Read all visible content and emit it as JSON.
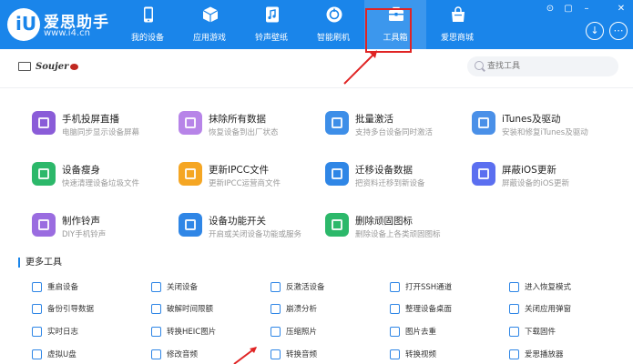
{
  "app": {
    "brand_name": "爱思助手",
    "brand_url": "www.i4.cn",
    "logo_glyph": "iU"
  },
  "nav": [
    {
      "label": "我的设备",
      "icon": "phone-icon"
    },
    {
      "label": "应用游戏",
      "icon": "cube-icon"
    },
    {
      "label": "铃声壁纸",
      "icon": "music-icon"
    },
    {
      "label": "智能刷机",
      "icon": "flash-icon"
    },
    {
      "label": "工具箱",
      "icon": "toolbox-icon"
    },
    {
      "label": "爱思商城",
      "icon": "shopping-bag-icon"
    }
  ],
  "window_controls": [
    "⊙",
    "▢",
    "–",
    "✕"
  ],
  "header_buttons": {
    "download": "↓",
    "more": "⋯"
  },
  "device": {
    "name": "Soujer"
  },
  "search": {
    "placeholder": "查找工具"
  },
  "tools": [
    {
      "title": "手机投屏直播",
      "desc": "电脑同步显示设备屏幕",
      "icon": "screen-mirror-icon",
      "color": "#8a5cd8"
    },
    {
      "title": "抹除所有数据",
      "desc": "恢复设备到出厂状态",
      "icon": "eraser-icon",
      "color": "#b784e8"
    },
    {
      "title": "批量激活",
      "desc": "支持多台设备同时激活",
      "icon": "batch-activate-icon",
      "color": "#3d8ee8"
    },
    {
      "title": "iTunes及驱动",
      "desc": "安装和修复iTunes及驱动",
      "icon": "itunes-icon",
      "color": "#4a90e8"
    },
    {
      "title": "设备瘦身",
      "desc": "快速清理设备垃圾文件",
      "icon": "broom-icon",
      "color": "#2cb86a"
    },
    {
      "title": "更新IPCC文件",
      "desc": "更新IPCC运营商文件",
      "icon": "ipcc-icon",
      "color": "#f5a623"
    },
    {
      "title": "迁移设备数据",
      "desc": "把资料迁移到新设备",
      "icon": "migrate-icon",
      "color": "#2f86e6"
    },
    {
      "title": "屏蔽iOS更新",
      "desc": "屏蔽设备的iOS更新",
      "icon": "block-update-icon",
      "color": "#5b6ff0"
    },
    {
      "title": "制作铃声",
      "desc": "DIY手机铃声",
      "icon": "ringtone-icon",
      "color": "#9a6ce0"
    },
    {
      "title": "设备功能开关",
      "desc": "开启或关闭设备功能或服务",
      "icon": "toggle-icon",
      "color": "#2f86e6"
    },
    {
      "title": "删除顽固图标",
      "desc": "删除设备上各类顽固图标",
      "icon": "trash-icon",
      "color": "#2cb86a"
    }
  ],
  "more_tools_title": "更多工具",
  "small_tools": [
    {
      "label": "重启设备",
      "icon": "restart-icon",
      "color": "#2f86e6"
    },
    {
      "label": "关闭设备",
      "icon": "power-icon",
      "color": "#2f86e6"
    },
    {
      "label": "反激活设备",
      "icon": "deactivate-icon",
      "color": "#2f86e6"
    },
    {
      "label": "打开SSH通道",
      "icon": "ssh-icon",
      "color": "#2f86e6"
    },
    {
      "label": "进入恢复模式",
      "icon": "recovery-icon",
      "color": "#2f86e6"
    },
    {
      "label": "备份引导数据",
      "icon": "backup-icon",
      "color": "#2f86e6"
    },
    {
      "label": "破解时间限额",
      "icon": "time-limit-icon",
      "color": "#2f86e6"
    },
    {
      "label": "崩溃分析",
      "icon": "crash-analysis-icon",
      "color": "#2f86e6"
    },
    {
      "label": "整理设备桌面",
      "icon": "desktop-organize-icon",
      "color": "#2f86e6"
    },
    {
      "label": "关闭应用弹窗",
      "icon": "close-popup-icon",
      "color": "#2f86e6"
    },
    {
      "label": "实时日志",
      "icon": "log-icon",
      "color": "#2f86e6"
    },
    {
      "label": "转换HEIC图片",
      "icon": "heic-icon",
      "color": "#2f86e6"
    },
    {
      "label": "压缩照片",
      "icon": "compress-photo-icon",
      "color": "#2f86e6"
    },
    {
      "label": "图片去重",
      "icon": "dedupe-icon",
      "color": "#2f86e6"
    },
    {
      "label": "下载固件",
      "icon": "firmware-icon",
      "color": "#2f86e6"
    },
    {
      "label": "虚拟U盘",
      "icon": "usb-icon",
      "color": "#2f86e6"
    },
    {
      "label": "修改音频",
      "icon": "audio-edit-icon",
      "color": "#2f86e6"
    },
    {
      "label": "转换音频",
      "icon": "audio-convert-icon",
      "color": "#2f86e6"
    },
    {
      "label": "转换视频",
      "icon": "video-convert-icon",
      "color": "#2f86e6"
    },
    {
      "label": "爱思播放器",
      "icon": "player-icon",
      "color": "#2f86e6"
    }
  ],
  "colors": {
    "header": "#1a85ea",
    "highlight": "#e02424",
    "accent": "#1a85ea"
  }
}
